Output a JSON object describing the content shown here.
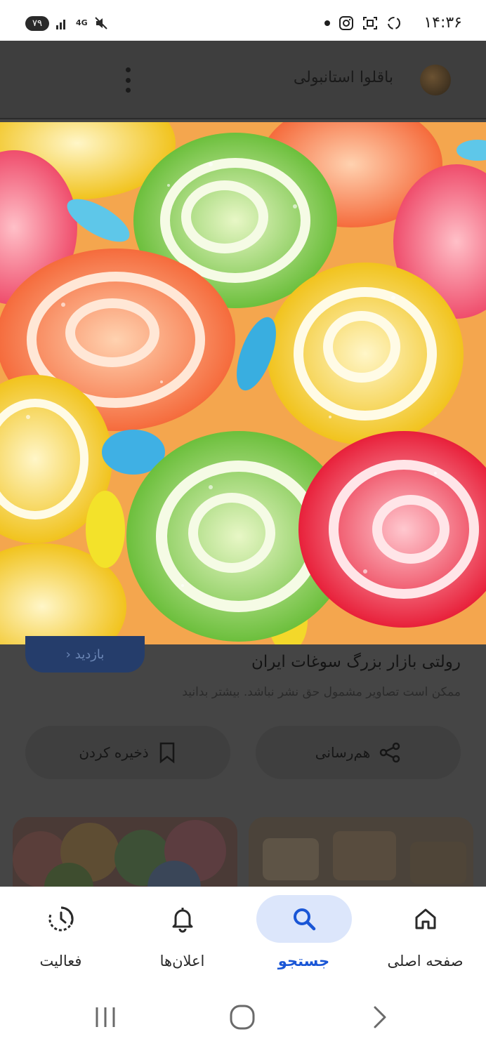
{
  "status_bar": {
    "time": "۱۴:۳۶",
    "battery": "۷۹",
    "network": "4G"
  },
  "header": {
    "store_name": "باقلوا استانبولی"
  },
  "result": {
    "visit_label": "بازدید",
    "title": "رولتی بازار بزرگ سوغات ایران",
    "notice": "ممکن است تصاویر مشمول حق نشر نباشد. بیشتر بدانید"
  },
  "actions": {
    "share_label": "هم‌رسانی",
    "save_label": "ذخیره کردن"
  },
  "bottom_nav": {
    "items": [
      {
        "label": "صفحه اصلی",
        "icon": "home-icon",
        "active": false
      },
      {
        "label": "جستجو",
        "icon": "search-icon",
        "active": true
      },
      {
        "label": "اعلان‌ها",
        "icon": "bell-icon",
        "active": false
      },
      {
        "label": "فعالیت",
        "icon": "activity-icon",
        "active": false
      }
    ]
  },
  "colors": {
    "accent": "#1a56d6",
    "active_bg": "#dce6fb",
    "scrim": "#454545"
  }
}
